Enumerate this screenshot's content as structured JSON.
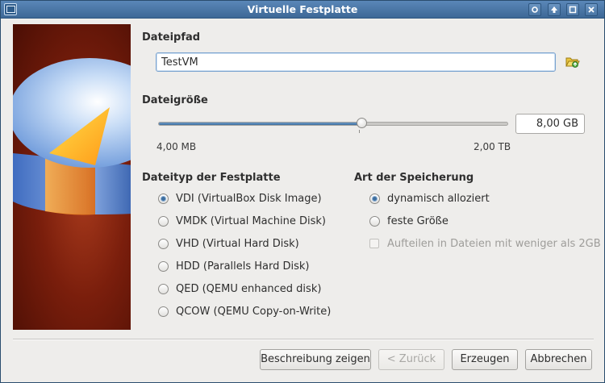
{
  "window": {
    "title": "Virtuelle Festplatte"
  },
  "file_path": {
    "label": "Dateipfad",
    "value": "TestVM"
  },
  "file_size": {
    "label": "Dateigröße",
    "value": "8,00 GB",
    "min_label": "4,00 MB",
    "max_label": "2,00 TB",
    "slider_position_fraction": 0.58
  },
  "disk_type": {
    "label": "Dateityp der Festplatte",
    "options": [
      {
        "label": "VDI (VirtualBox Disk Image)",
        "checked": true
      },
      {
        "label": "VMDK (Virtual Machine Disk)",
        "checked": false
      },
      {
        "label": "VHD (Virtual Hard Disk)",
        "checked": false
      },
      {
        "label": "HDD (Parallels Hard Disk)",
        "checked": false
      },
      {
        "label": "QED (QEMU enhanced disk)",
        "checked": false
      },
      {
        "label": "QCOW (QEMU Copy-on-Write)",
        "checked": false
      }
    ]
  },
  "storage": {
    "label": "Art der Speicherung",
    "options": [
      {
        "label": "dynamisch alloziert",
        "checked": true
      },
      {
        "label": "feste Größe",
        "checked": false
      }
    ],
    "split_checkbox": {
      "label": "Aufteilen in Dateien mit weniger als 2GB",
      "checked": false,
      "enabled": false
    }
  },
  "buttons": {
    "description": "Beschreibung zeigen",
    "back": "< Zurück",
    "create": "Erzeugen",
    "cancel": "Abbrechen"
  },
  "icons": {
    "app": "virtualbox-icon",
    "folder": "folder-open-icon"
  },
  "colors": {
    "titlebar": "#4a76a5",
    "accent": "#3f6f9f",
    "input_focus": "#7aa3cf",
    "banner_bg": "#7a1e0c"
  }
}
